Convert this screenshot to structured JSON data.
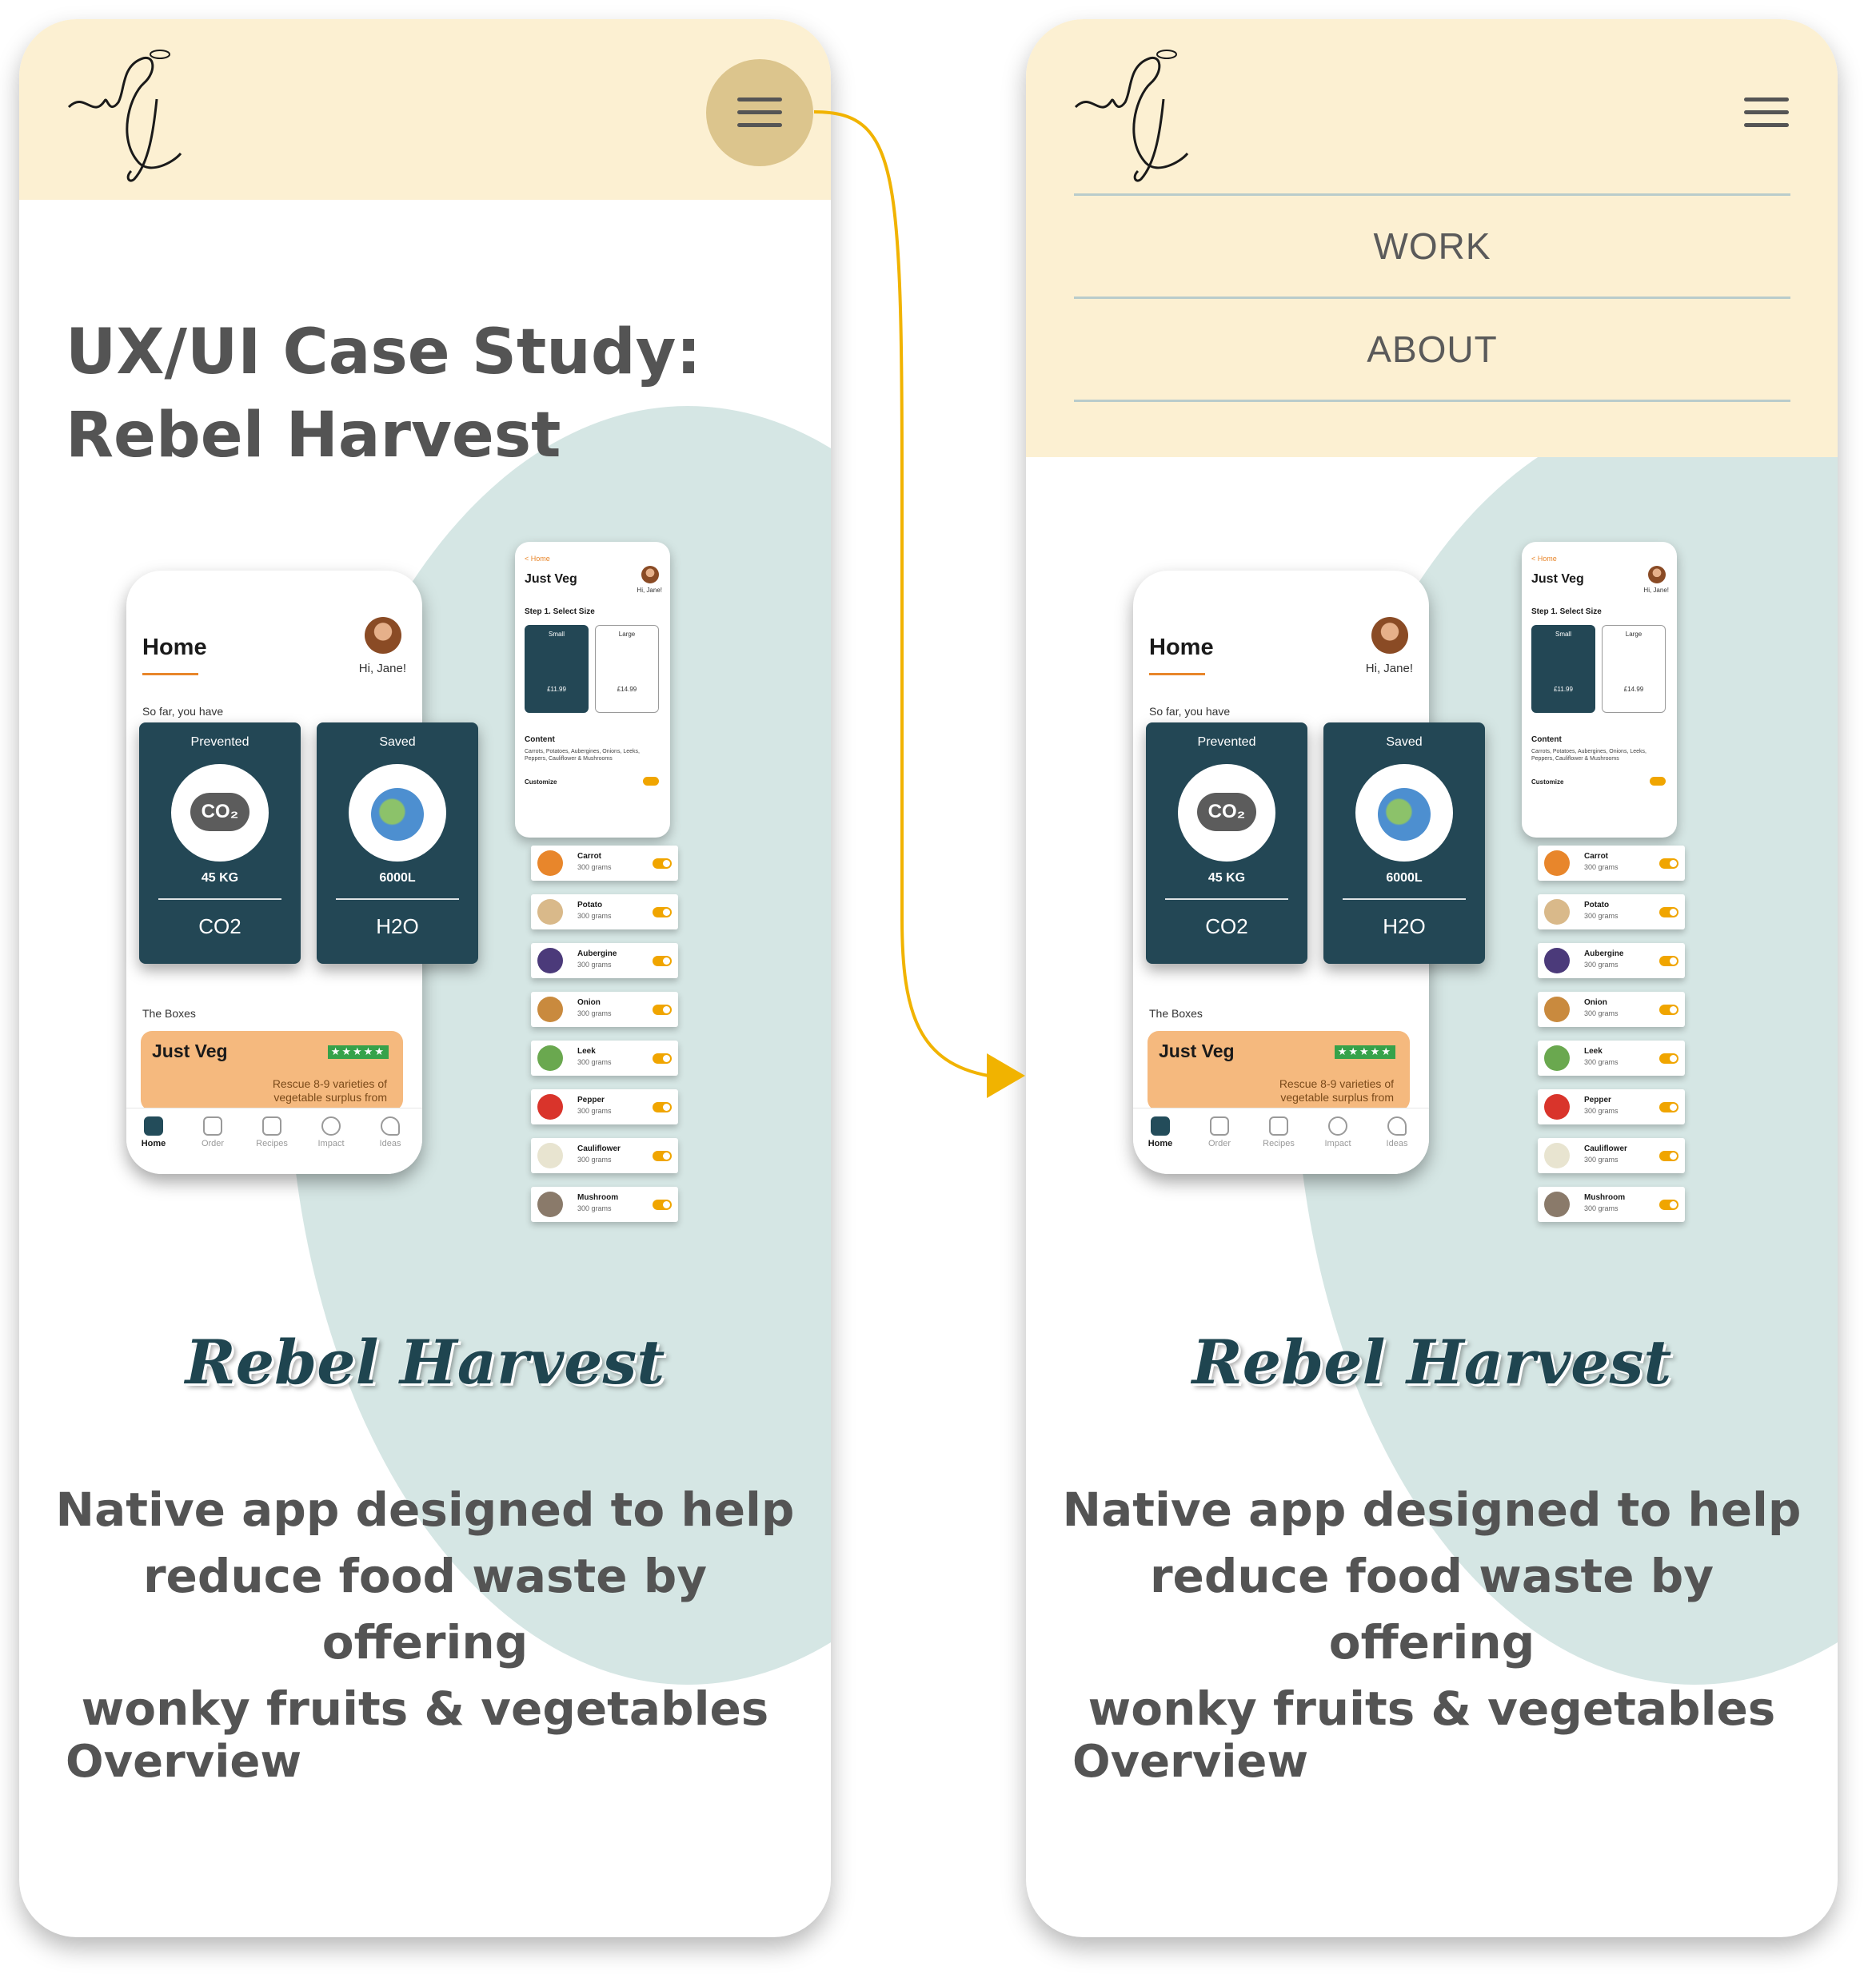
{
  "colors": {
    "header_bg": "#fcf0d2",
    "menu_highlight": "#dcc58d",
    "blob": "#d5e6e4",
    "card_dark": "#234755",
    "arrow": "#f1b300",
    "text": "#545454",
    "brand": "#1f4550"
  },
  "screens": [
    {
      "id": "left",
      "menu_open": false,
      "menu_items": [],
      "title_line1": "UX/UI Case Study:",
      "title_line2": "Rebel Harvest"
    },
    {
      "id": "right",
      "menu_open": true,
      "menu_items": [
        "WORK",
        "ABOUT"
      ]
    }
  ],
  "mockup": {
    "home_title": "Home",
    "greeting": "Hi, Jane!",
    "so_far": "So far, you have",
    "cards": [
      {
        "label": "Prevented",
        "badge": "CO₂",
        "value": "45 KG",
        "unit": "CO2"
      },
      {
        "label": "Saved",
        "badge": "",
        "value": "6000L",
        "unit": "H2O"
      }
    ],
    "boxes_label": "The Boxes",
    "box_title": "Just Veg",
    "box_stars": "★★★★★",
    "box_desc": "Rescue 8-9 varieties of vegetable surplus from",
    "tabs": [
      "Home",
      "Order",
      "Recipes",
      "Impact",
      "Ideas"
    ],
    "detail": {
      "back": "< Home",
      "title": "Just Veg",
      "greeting": "Hi, Jane!",
      "step": "Step 1. Select Size",
      "small": {
        "name": "Small",
        "price": "£11.99"
      },
      "large": {
        "name": "Large",
        "price": "£14.99"
      },
      "content_label": "Content",
      "content_text": "Carrots, Potatoes, Aubergines, Onions, Leeks, Peppers, Cauliflower & Mushrooms",
      "customize": "Customize"
    },
    "veg": [
      {
        "name": "Carrot",
        "qty": "300 grams",
        "color": "#e8862b"
      },
      {
        "name": "Potato",
        "qty": "300 grams",
        "color": "#d9b98a"
      },
      {
        "name": "Aubergine",
        "qty": "300 grams",
        "color": "#4b3a7a"
      },
      {
        "name": "Onion",
        "qty": "300 grams",
        "color": "#c98a3e"
      },
      {
        "name": "Leek",
        "qty": "300 grams",
        "color": "#6aa84f"
      },
      {
        "name": "Pepper",
        "qty": "300 grams",
        "color": "#d9342b"
      },
      {
        "name": "Cauliflower",
        "qty": "300 grams",
        "color": "#e8e4d0"
      },
      {
        "name": "Mushroom",
        "qty": "300 grams",
        "color": "#8a7a6a"
      }
    ]
  },
  "brand": "Rebel Harvest",
  "tagline_lines": [
    "Native app designed to help",
    "reduce food waste by offering",
    "wonky fruits & vegetables"
  ],
  "overview": "Overview"
}
